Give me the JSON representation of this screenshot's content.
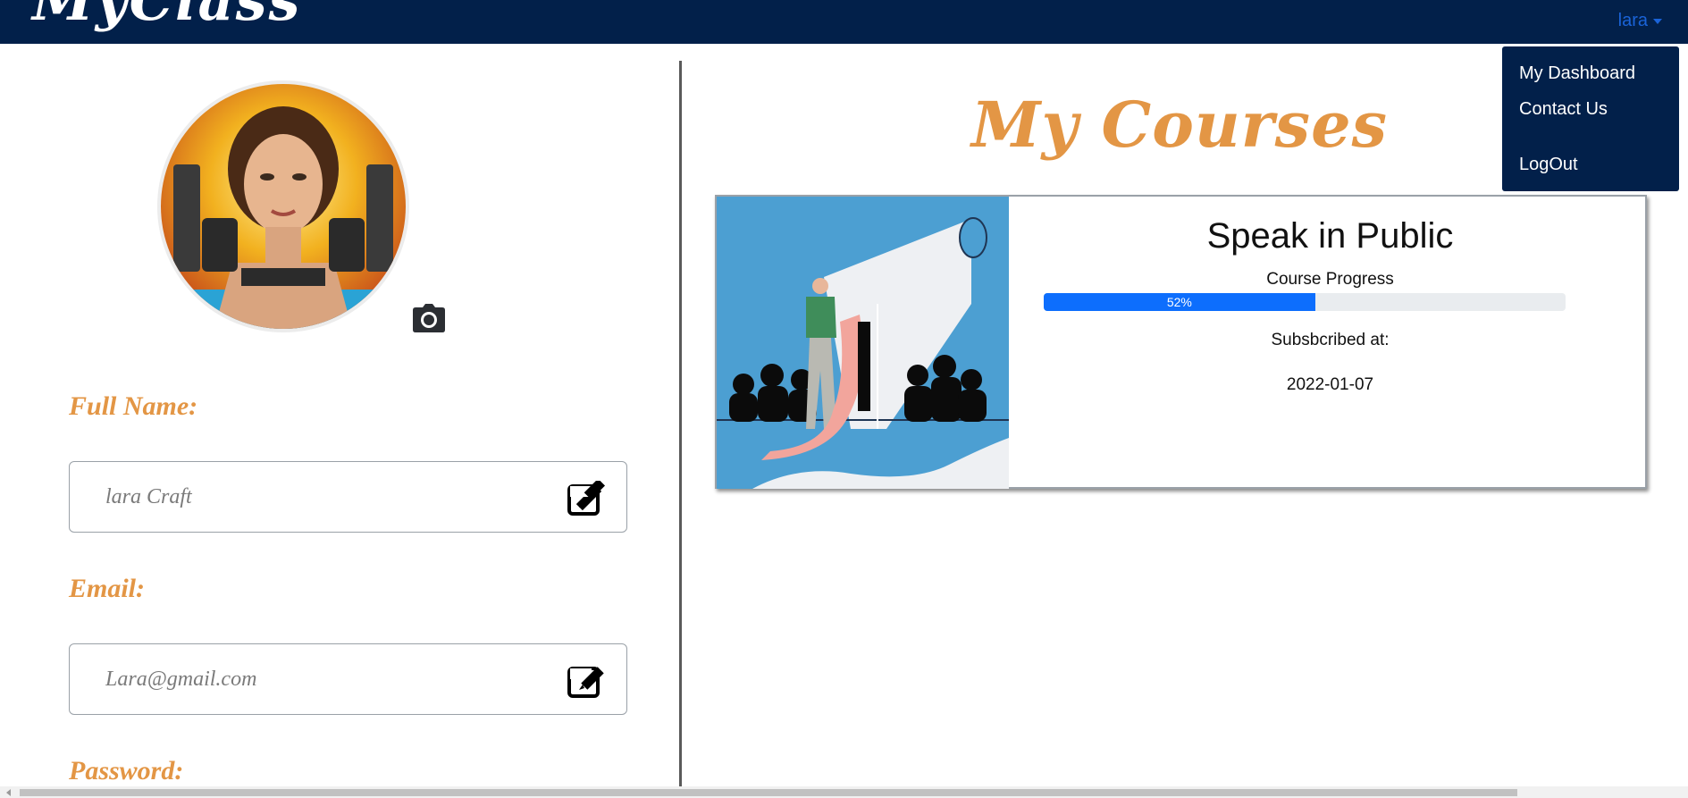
{
  "navbar": {
    "brand": "MyClass",
    "user_label": "lara",
    "background": "#02204a"
  },
  "user_menu": {
    "items": [
      "My Dashboard",
      "Contact Us",
      "LogOut"
    ]
  },
  "profile": {
    "avatar_icon": "user-avatar-photo",
    "camera_icon": "camera-icon",
    "fields": [
      {
        "label": "Full Name:",
        "value": "lara Craft",
        "icon": "edit-icon"
      },
      {
        "label": "Email:",
        "value": "Lara@gmail.com",
        "icon": "edit-icon"
      },
      {
        "label": "Password:"
      }
    ]
  },
  "courses": {
    "heading": "My Courses",
    "items": [
      {
        "title": "Speak in Public",
        "progress_label": "Course Progress",
        "progress_percent": 52,
        "progress_text": "52%",
        "subscribed_label": "Subsbcribed at:",
        "subscribed_date": "2022-01-07"
      }
    ]
  },
  "colors": {
    "accent": "#e39645",
    "progress": "#0d6efd",
    "user_link": "#1a63d8"
  }
}
